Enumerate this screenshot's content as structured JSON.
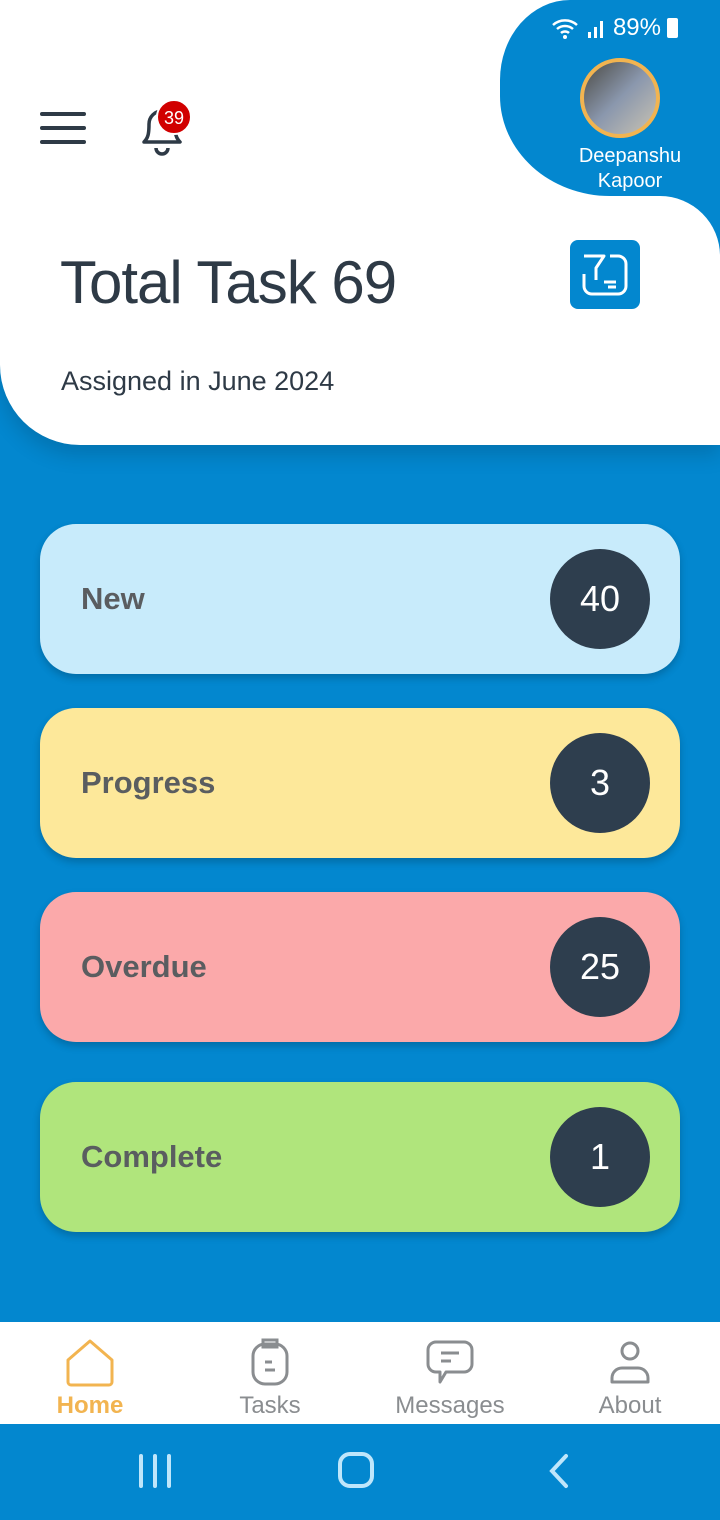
{
  "status_bar": {
    "battery": "89%"
  },
  "header": {
    "notification_count": "39",
    "user_name_line1": "Deepanshu",
    "user_name_line2": "Kapoor",
    "title": "Total Task 69",
    "subtitle": "Assigned in June 2024"
  },
  "cards": [
    {
      "label": "New",
      "count": "40",
      "color": "#c8ebfb"
    },
    {
      "label": "Progress",
      "count": "3",
      "color": "#fde89a"
    },
    {
      "label": "Overdue",
      "count": "25",
      "color": "#fba9aa"
    },
    {
      "label": "Complete",
      "count": "1",
      "color": "#b0e57c"
    }
  ],
  "bottom_nav": {
    "items": [
      {
        "label": "Home",
        "active": true
      },
      {
        "label": "Tasks"
      },
      {
        "label": "Messages"
      },
      {
        "label": "About"
      }
    ]
  },
  "colors": {
    "primary": "#0387cf",
    "active_nav": "#f2b450",
    "count_bg": "#2e3e4e"
  }
}
